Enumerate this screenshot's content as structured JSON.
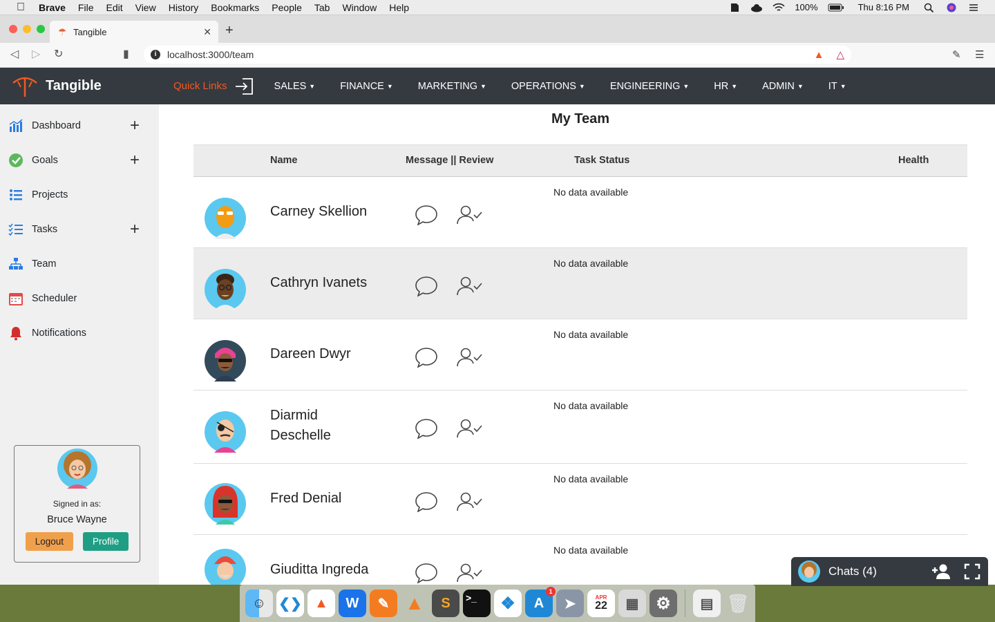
{
  "os_menubar": {
    "app_name": "Brave",
    "items": [
      "File",
      "Edit",
      "View",
      "History",
      "Bookmarks",
      "People",
      "Tab",
      "Window",
      "Help"
    ],
    "battery": "100%",
    "clock": "Thu 8:16 PM"
  },
  "browser": {
    "tab_title": "Tangible",
    "url": "localhost:3000/team"
  },
  "app": {
    "brand": "Tangible",
    "quick_links": "Quick Links",
    "menu": [
      "SALES",
      "FINANCE",
      "MARKETING",
      "OPERATIONS",
      "ENGINEERING",
      "HR",
      "ADMIN",
      "IT"
    ]
  },
  "sidebar": {
    "items": [
      {
        "label": "Dashboard",
        "has_add": true
      },
      {
        "label": "Goals",
        "has_add": true
      },
      {
        "label": "Projects",
        "has_add": false
      },
      {
        "label": "Tasks",
        "has_add": true
      },
      {
        "label": "Team",
        "has_add": false
      },
      {
        "label": "Scheduler",
        "has_add": false
      },
      {
        "label": "Notifications",
        "has_add": false
      }
    ],
    "user": {
      "signed_in_label": "Signed in as:",
      "name": "Bruce Wayne",
      "logout": "Logout",
      "profile": "Profile"
    }
  },
  "main": {
    "title": "My Team",
    "columns": {
      "name": "Name",
      "message_review": "Message || Review",
      "task_status": "Task Status",
      "health": "Health"
    },
    "members": [
      {
        "name": "Carney Skellion",
        "task_status": "No data available"
      },
      {
        "name": "Cathryn Ivanets",
        "task_status": "No data available"
      },
      {
        "name": "Dareen Dwyr",
        "task_status": "No data available"
      },
      {
        "name": "Diarmid Deschelle",
        "task_status": "No data available"
      },
      {
        "name": "Fred Denial",
        "task_status": "No data available"
      },
      {
        "name": "Giuditta Ingreda",
        "task_status": "No data available"
      }
    ]
  },
  "chat": {
    "label": "Chats (4)"
  },
  "dock": {
    "calendar_month": "APR",
    "calendar_day": "22",
    "app_store_badge": "1"
  },
  "colors": {
    "header_bg": "#343a40",
    "accent_orange": "#f05a24",
    "logout_btn": "#f0a04b",
    "profile_btn": "#1f9e84",
    "sidebar_bg": "#f0f0f0"
  }
}
